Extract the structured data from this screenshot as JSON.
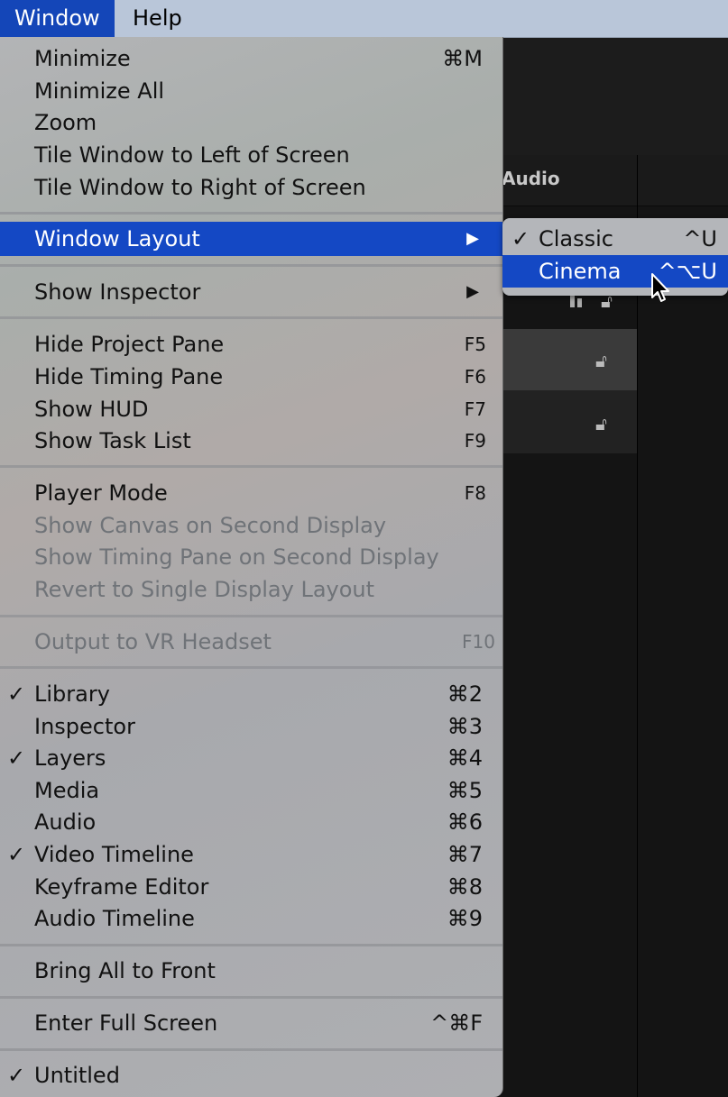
{
  "menubar": {
    "window_label": "Window",
    "help_label": "Help"
  },
  "background": {
    "header_label": "Audio"
  },
  "menu": {
    "items": [
      {
        "label": "Minimize",
        "shortcut": "⌘M"
      },
      {
        "label": "Minimize All"
      },
      {
        "label": "Zoom"
      },
      {
        "label": "Tile Window to Left of Screen"
      },
      {
        "label": "Tile Window to Right of Screen"
      },
      {
        "label": "Window Layout",
        "submenu": "▶"
      },
      {
        "label": "Show Inspector",
        "submenu": "▶"
      },
      {
        "label": "Hide Project Pane",
        "shortcut": "F5"
      },
      {
        "label": "Hide Timing Pane",
        "shortcut": "F6"
      },
      {
        "label": "Show HUD",
        "shortcut": "F7"
      },
      {
        "label": "Show Task List",
        "shortcut": "F9"
      },
      {
        "label": "Player Mode",
        "shortcut": "F8"
      },
      {
        "label": "Show Canvas on Second Display",
        "disabled": true
      },
      {
        "label": "Show Timing Pane on Second Display",
        "disabled": true
      },
      {
        "label": "Revert to Single Display Layout",
        "disabled": true
      },
      {
        "label": "Output to VR Headset",
        "shortcut": "F10",
        "disabled": true
      },
      {
        "label": "Library",
        "shortcut": "⌘2",
        "checked": "✓"
      },
      {
        "label": "Inspector",
        "shortcut": "⌘3"
      },
      {
        "label": "Layers",
        "shortcut": "⌘4",
        "checked": "✓"
      },
      {
        "label": "Media",
        "shortcut": "⌘5"
      },
      {
        "label": "Audio",
        "shortcut": "⌘6"
      },
      {
        "label": "Video Timeline",
        "shortcut": "⌘7",
        "checked": "✓"
      },
      {
        "label": "Keyframe Editor",
        "shortcut": "⌘8"
      },
      {
        "label": "Audio Timeline",
        "shortcut": "⌘9"
      },
      {
        "label": "Bring All to Front"
      },
      {
        "label": "Enter Full Screen",
        "shortcut": "^⌘F"
      },
      {
        "label": "Untitled",
        "checked": "✓"
      }
    ]
  },
  "submenu": {
    "items": [
      {
        "label": "Classic",
        "shortcut": "^U",
        "checked": "✓"
      },
      {
        "label": "Cinema",
        "shortcut": "^⌥U"
      }
    ]
  },
  "colors": {
    "highlight": "#1448c4",
    "menubar": "#b9c6d9"
  }
}
